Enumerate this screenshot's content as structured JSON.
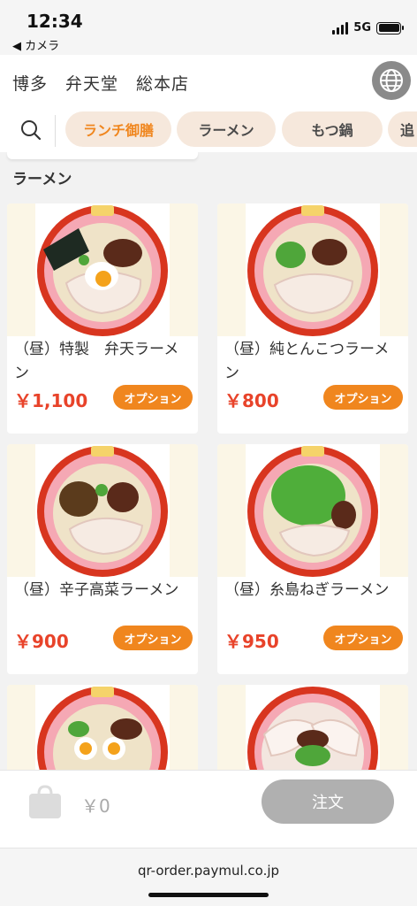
{
  "status_bar": {
    "time": "12:34",
    "back_label": "◀ カメラ",
    "network": "5G"
  },
  "header": {
    "store_name": "博多　弁天堂　総本店"
  },
  "categories": [
    {
      "label": "ランチ御膳",
      "active": true
    },
    {
      "label": "ラーメン",
      "active": false
    },
    {
      "label": "もつ鍋",
      "active": false
    },
    {
      "label": "追",
      "active": false
    }
  ],
  "section": {
    "title": "ラーメン"
  },
  "items": [
    {
      "name": "（昼）特製　弁天ラーメン",
      "price": "￥1,100",
      "option_label": "オプション",
      "image": "tokusei-benten-ramen"
    },
    {
      "name": "（昼）純とんこつラーメン",
      "price": "￥800",
      "option_label": "オプション",
      "image": "jun-tonkotsu-ramen"
    },
    {
      "name": "（昼）辛子高菜ラーメン",
      "price": "￥900",
      "option_label": "オプション",
      "image": "karashi-takana-ramen"
    },
    {
      "name": "（昼）糸島ねぎラーメン",
      "price": "￥950",
      "option_label": "オプション",
      "image": "itoshima-negi-ramen"
    },
    {
      "name": "",
      "price": "",
      "option_label": "",
      "image": "egg-ramen"
    },
    {
      "name": "",
      "price": "",
      "option_label": "",
      "image": "chashu-ramen"
    }
  ],
  "cart": {
    "total": "￥0",
    "order_label": "注文"
  },
  "browser": {
    "url": "qr-order.paymul.co.jp"
  },
  "colors": {
    "accent": "#f0861e",
    "price": "#e8432a",
    "chip_bg": "#f6e8dc",
    "disabled": "#b0b0b0"
  }
}
